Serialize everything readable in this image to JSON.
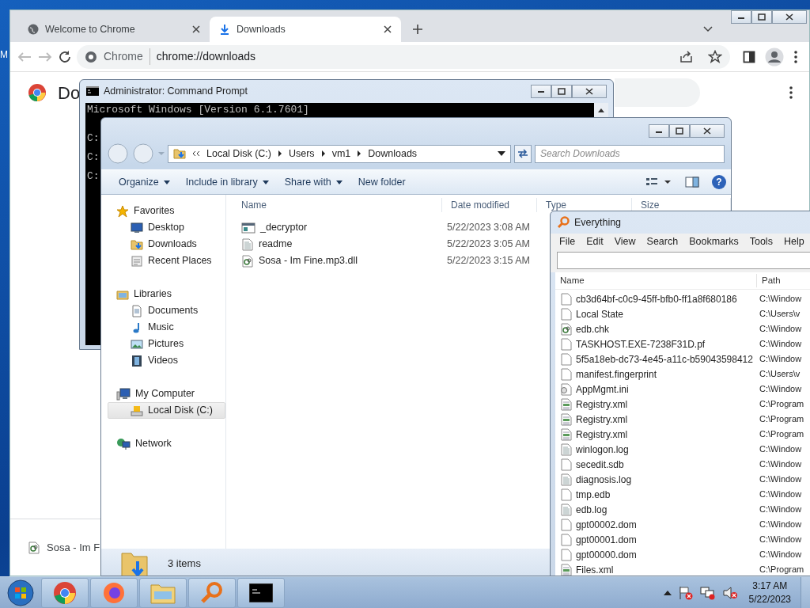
{
  "desktop": {
    "icon_label": "M"
  },
  "chrome": {
    "tabs": [
      {
        "label": "Welcome to Chrome",
        "selected": false,
        "kind": "globe"
      },
      {
        "label": "Downloads",
        "selected": true,
        "kind": "download"
      }
    ],
    "omnibox": {
      "chip": "Chrome",
      "url": "chrome://downloads"
    },
    "page_title": "Do",
    "download_item": "Sosa - Im F"
  },
  "cmd": {
    "title": "Administrator:  Command Prompt",
    "lines": [
      "Microsoft Windows [Version 6.1.7601]",
      "C:",
      "C:",
      "C:"
    ]
  },
  "explorer": {
    "breadcrumb": [
      "Local Disk (C:)",
      "Users",
      "vm1",
      "Downloads"
    ],
    "search": {
      "placeholder": "Search Downloads"
    },
    "toolbar": [
      {
        "label": "Organize",
        "dropdown": true
      },
      {
        "label": "Include in library",
        "dropdown": true
      },
      {
        "label": "Share with",
        "dropdown": true
      },
      {
        "label": "New folder",
        "dropdown": false
      }
    ],
    "nav": [
      {
        "label": "Favorites",
        "kind": "star",
        "selected": false,
        "children": [
          {
            "label": "Desktop",
            "kind": "desktop",
            "selected": false
          },
          {
            "label": "Downloads",
            "kind": "downloads",
            "selected": false
          },
          {
            "label": "Recent Places",
            "kind": "recent",
            "selected": false
          }
        ]
      },
      {
        "label": "Libraries",
        "kind": "library",
        "selected": false,
        "children": [
          {
            "label": "Documents",
            "kind": "documents",
            "selected": false
          },
          {
            "label": "Music",
            "kind": "music",
            "selected": false
          },
          {
            "label": "Pictures",
            "kind": "pictures",
            "selected": false
          },
          {
            "label": "Videos",
            "kind": "videos",
            "selected": false
          }
        ]
      },
      {
        "label": "My Computer",
        "kind": "computer",
        "selected": false,
        "children": [
          {
            "label": "Local Disk (C:)",
            "kind": "disk",
            "selected": true
          }
        ]
      },
      {
        "label": "Network",
        "kind": "network",
        "selected": false
      }
    ],
    "columns": [
      "Name",
      "Date modified",
      "Type",
      "Size"
    ],
    "files": [
      {
        "name": "_decryptor",
        "date": "5/22/2023 3:08 AM",
        "kind": "app"
      },
      {
        "name": "readme",
        "date": "5/22/2023 3:05 AM",
        "kind": "text"
      },
      {
        "name": "Sosa - Im Fine.mp3.dll",
        "date": "5/22/2023 3:15 AM",
        "kind": "gear"
      }
    ],
    "status": "3 items",
    "help_glyph": "?"
  },
  "everything": {
    "title": "Everything",
    "menu": [
      "File",
      "Edit",
      "View",
      "Search",
      "Bookmarks",
      "Tools",
      "Help"
    ],
    "columns": [
      "Name",
      "Path"
    ],
    "rows": [
      {
        "name": "cb3d64bf-c0c9-45ff-bfb0-ff1a8f680186",
        "path": "C:\\Window",
        "kind": "blank"
      },
      {
        "name": "Local State",
        "path": "C:\\Users\\v",
        "kind": "blank"
      },
      {
        "name": "edb.chk",
        "path": "C:\\Window",
        "kind": "gear"
      },
      {
        "name": "TASKHOST.EXE-7238F31D.pf",
        "path": "C:\\Window",
        "kind": "blank"
      },
      {
        "name": "5f5a18eb-dc73-4e45-a11c-b59043598412",
        "path": "C:\\Window",
        "kind": "blank"
      },
      {
        "name": "manifest.fingerprint",
        "path": "C:\\Users\\v",
        "kind": "blank"
      },
      {
        "name": "AppMgmt.ini",
        "path": "C:\\Window",
        "kind": "ini"
      },
      {
        "name": "Registry.xml",
        "path": "C:\\Program",
        "kind": "xml"
      },
      {
        "name": "Registry.xml",
        "path": "C:\\Program",
        "kind": "xml"
      },
      {
        "name": "Registry.xml",
        "path": "C:\\Program",
        "kind": "xml"
      },
      {
        "name": "winlogon.log",
        "path": "C:\\Window",
        "kind": "text"
      },
      {
        "name": "secedit.sdb",
        "path": "C:\\Window",
        "kind": "blank"
      },
      {
        "name": "diagnosis.log",
        "path": "C:\\Window",
        "kind": "text"
      },
      {
        "name": "tmp.edb",
        "path": "C:\\Window",
        "kind": "blank"
      },
      {
        "name": "edb.log",
        "path": "C:\\Window",
        "kind": "text"
      },
      {
        "name": "gpt00002.dom",
        "path": "C:\\Window",
        "kind": "blank"
      },
      {
        "name": "gpt00001.dom",
        "path": "C:\\Window",
        "kind": "blank"
      },
      {
        "name": "gpt00000.dom",
        "path": "C:\\Window",
        "kind": "blank"
      },
      {
        "name": "Files.xml",
        "path": "C:\\Program",
        "kind": "xml"
      }
    ]
  },
  "taskbar": {
    "apps": [
      {
        "kind": "chrome"
      },
      {
        "kind": "firefox"
      },
      {
        "kind": "explorer"
      },
      {
        "kind": "everything"
      },
      {
        "kind": "cmd"
      }
    ],
    "clock": {
      "time": "3:17 AM",
      "date": "5/22/2023"
    }
  }
}
